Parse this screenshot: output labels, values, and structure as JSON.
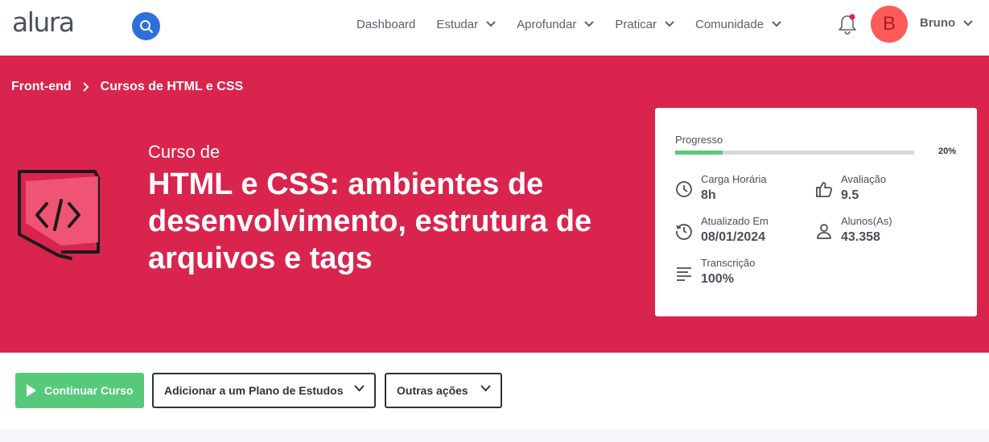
{
  "header": {
    "logo": "alura",
    "nav": [
      {
        "label": "Dashboard",
        "dropdown": false
      },
      {
        "label": "Estudar",
        "dropdown": true
      },
      {
        "label": "Aprofundar",
        "dropdown": true
      },
      {
        "label": "Praticar",
        "dropdown": true
      },
      {
        "label": "Comunidade",
        "dropdown": true
      }
    ],
    "avatar_initial": "B",
    "user_name": "Bruno"
  },
  "breadcrumb": {
    "items": [
      "Front-end",
      "Cursos de HTML e CSS"
    ]
  },
  "course": {
    "pre_title": "Curso de",
    "title": "HTML e CSS: ambientes de desenvolvimento, estrutura de arquivos e tags"
  },
  "stats": {
    "progress_label": "Progresso",
    "progress_value": 0.2,
    "progress_text": "20%",
    "workload_label": "Carga Horária",
    "workload_value": "8h",
    "rating_label": "Avaliação",
    "rating_value": "9.5",
    "updated_label": "Atualizado Em",
    "updated_value": "08/01/2024",
    "students_label": "Alunos(As)",
    "students_value": "43.358",
    "transcript_label": "Transcrição",
    "transcript_value": "100%"
  },
  "actions": {
    "continue_label": "Continuar Curso",
    "plan_label": "Adicionar a um Plano de Estudos",
    "other_label": "Outras ações"
  },
  "colors": {
    "brand": "#d9244e",
    "accent_blue": "#2f6fdb",
    "success": "#57c97b",
    "avatar": "#ff5a5a"
  }
}
